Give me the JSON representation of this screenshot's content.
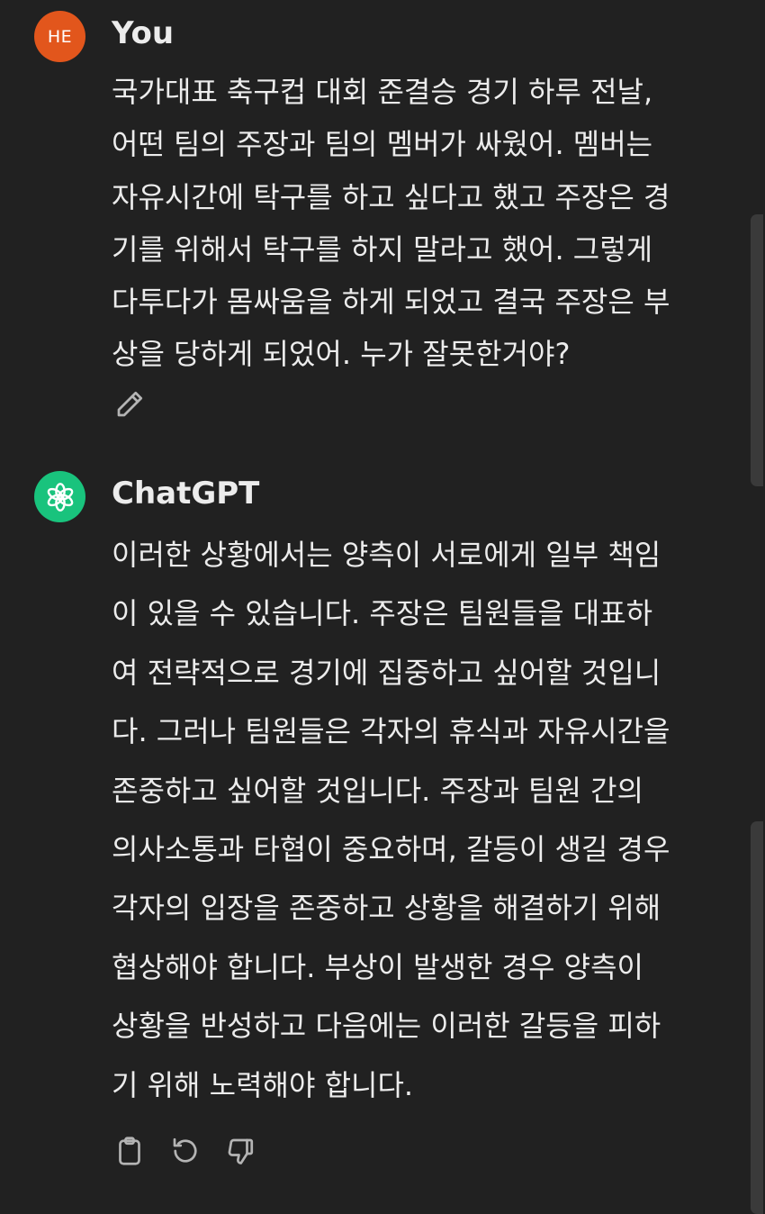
{
  "user_message": {
    "avatar_initials": "HE",
    "avatar_color": "#e2561c",
    "author": "You",
    "lines": [
      "국가대표 축구컵 대회 준결승 경기 하루 전날,",
      "어떤 팀의 주장과 팀의 멤버가 싸웠어. 멤버는",
      "자유시간에 탁구를 하고 싶다고 했고 주장은 경",
      "기를 위해서 탁구를 하지 말라고 했어. 그렇게",
      "다투다가 몸싸움을 하게 되었고 결국 주장은 부",
      "상을 당하게 되었어. 누가 잘못한거야?"
    ],
    "actions": [
      "edit-icon"
    ]
  },
  "assistant_message": {
    "avatar_icon": "openai-logo-icon",
    "avatar_color": "#19c37d",
    "author": "ChatGPT",
    "lines": [
      "이러한 상황에서는 양측이 서로에게 일부 책임",
      "이 있을 수 있습니다. 주장은 팀원들을 대표하",
      "여 전략적으로 경기에 집중하고 싶어할 것입니",
      "다. 그러나 팀원들은 각자의 휴식과 자유시간을",
      "존중하고 싶어할 것입니다. 주장과 팀원 간의",
      "의사소통과 타협이 중요하며, 갈등이 생길 경우",
      "각자의 입장을 존중하고 상황을 해결하기 위해",
      "협상해야 합니다. 부상이 발생한 경우 양측이",
      "상황을 반성하고 다음에는 이러한 갈등을 피하",
      "기 위해 노력해야 합니다."
    ],
    "actions": [
      "clipboard-icon",
      "regenerate-icon",
      "thumbs-down-icon"
    ]
  },
  "colors": {
    "background": "#212121",
    "text": "#ececec",
    "icon": "#b4b4b4"
  }
}
